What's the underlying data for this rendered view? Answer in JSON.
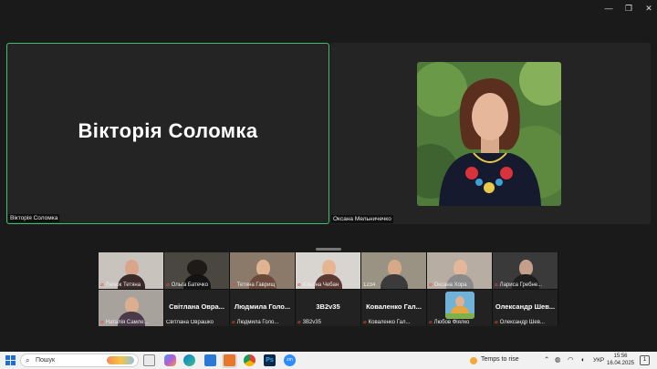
{
  "window": {
    "minimize_glyph": "—",
    "restore_glyph": "❐",
    "close_glyph": "✕"
  },
  "main_speaker": {
    "display_name": "Вікторія  Соломка",
    "tag": "Вікторія Соломка"
  },
  "second_speaker": {
    "tag": "Оксана Мельничечко"
  },
  "gallery": [
    {
      "label": "Лапюк Тетяна",
      "muted": true,
      "video": true
    },
    {
      "label": "Ольга Батечко",
      "muted": true,
      "video": true
    },
    {
      "label": "Тетяна Гаврищ",
      "muted": true,
      "video": true
    },
    {
      "label": "Альона Чебан",
      "muted": true,
      "video": true
    },
    {
      "label": "1234",
      "muted": false,
      "video": true
    },
    {
      "label": "Оксана Хора",
      "muted": true,
      "video": true
    },
    {
      "label": "Лариса Гребне...",
      "muted": true,
      "video": true
    },
    {
      "label": "Наталія Самле...",
      "muted": true,
      "video": true
    },
    {
      "label": "Світлана Оврашко",
      "title": "Світлана Овра...",
      "muted": false,
      "video": false
    },
    {
      "label": "Людмила Голо...",
      "title": "Людмила Голо...",
      "muted": true,
      "video": false
    },
    {
      "label": "3В2v35",
      "title": "3В2v35",
      "muted": true,
      "video": false
    },
    {
      "label": "Коваленко Гал...",
      "title": "Коваленко Гал...",
      "muted": true,
      "video": false
    },
    {
      "label": "Любов Фіялко",
      "muted": true,
      "video": true
    },
    {
      "label": "Олександр Шев...",
      "title": "Олександр Шев...",
      "muted": true,
      "video": false
    }
  ],
  "taskbar": {
    "search_placeholder": "Пошук",
    "weather": "Temps to rise",
    "language": "УКР",
    "time": "15:56",
    "date": "16.04.2025",
    "notification_count": "1",
    "icons": [
      "copilot-icon",
      "task-view-icon",
      "edge-icon",
      "store-icon",
      "zoom-app-icon",
      "chrome-icon",
      "photoshop-icon",
      "zoom-icon"
    ]
  },
  "colors": {
    "active_speaker_border": "#3dbf6f",
    "muted_mic": "#e04a4a",
    "tile_bg": "#242424"
  }
}
